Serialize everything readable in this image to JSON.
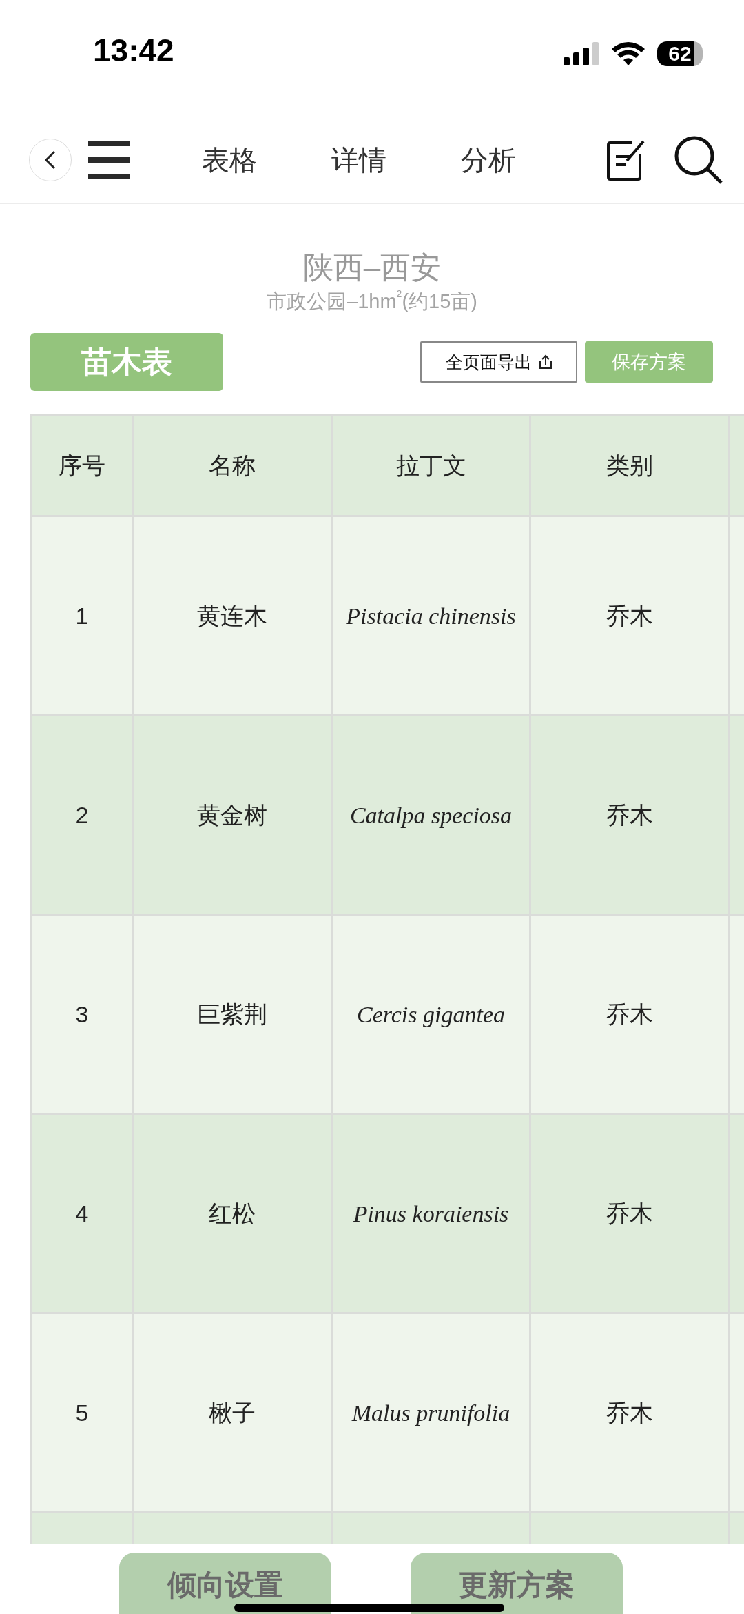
{
  "status_bar": {
    "time": "13:42",
    "battery": "62"
  },
  "nav": {
    "tabs": [
      "表格",
      "详情",
      "分析"
    ]
  },
  "header": {
    "title": "陕西–西安",
    "subtitle": "市政公园–1hm$^{2}$(约15亩)"
  },
  "table_label": "苗木表",
  "actions": {
    "export": "全页面导出",
    "save": "保存方案"
  },
  "table": {
    "columns": [
      "序号",
      "名称",
      "拉丁文",
      "类别"
    ],
    "rows": [
      {
        "index": "1",
        "name": "黄连木",
        "latin": "Pistacia chinensis",
        "category": "乔木"
      },
      {
        "index": "2",
        "name": "黄金树",
        "latin": "Catalpa speciosa",
        "category": "乔木"
      },
      {
        "index": "3",
        "name": "巨紫荆",
        "latin": "Cercis gigantea",
        "category": "乔木"
      },
      {
        "index": "4",
        "name": "红松",
        "latin": "Pinus koraiensis",
        "category": "乔木"
      },
      {
        "index": "5",
        "name": "楸子",
        "latin": "Malus prunifolia",
        "category": "乔木"
      }
    ]
  },
  "footer_buttons": [
    "倾向设置",
    "更新方案"
  ]
}
